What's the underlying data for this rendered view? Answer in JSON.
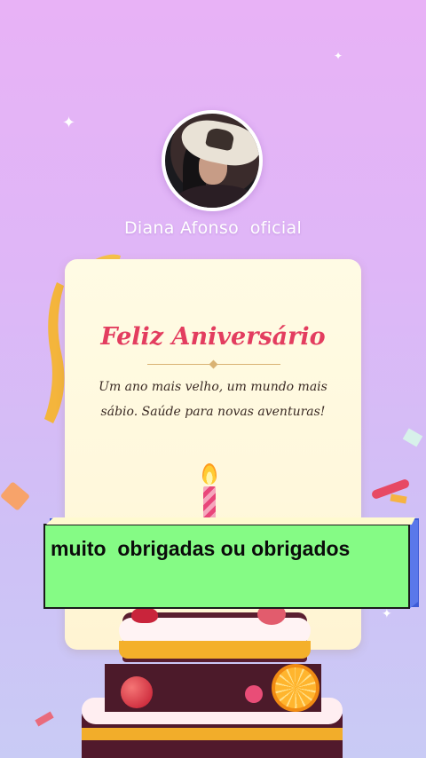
{
  "profile": {
    "name": "Diana Afonso  oficial"
  },
  "card": {
    "title": "Feliz Aniversário",
    "message_line1": "Um ano mais velho, um mundo mais",
    "message_line2": "sábio. Saúde para novas aventuras!"
  },
  "banner": {
    "text": "muito  obrigadas ou obrigados"
  },
  "colors": {
    "background_top": "#e8b2f6",
    "background_bottom": "#c9cbf5",
    "title": "#e33d5f",
    "banner_fill": "#85fb85",
    "banner_edge": "#3d5bd6"
  },
  "icons": [
    "sparkle-icon",
    "candle-icon",
    "cake-illustration",
    "confetti"
  ]
}
